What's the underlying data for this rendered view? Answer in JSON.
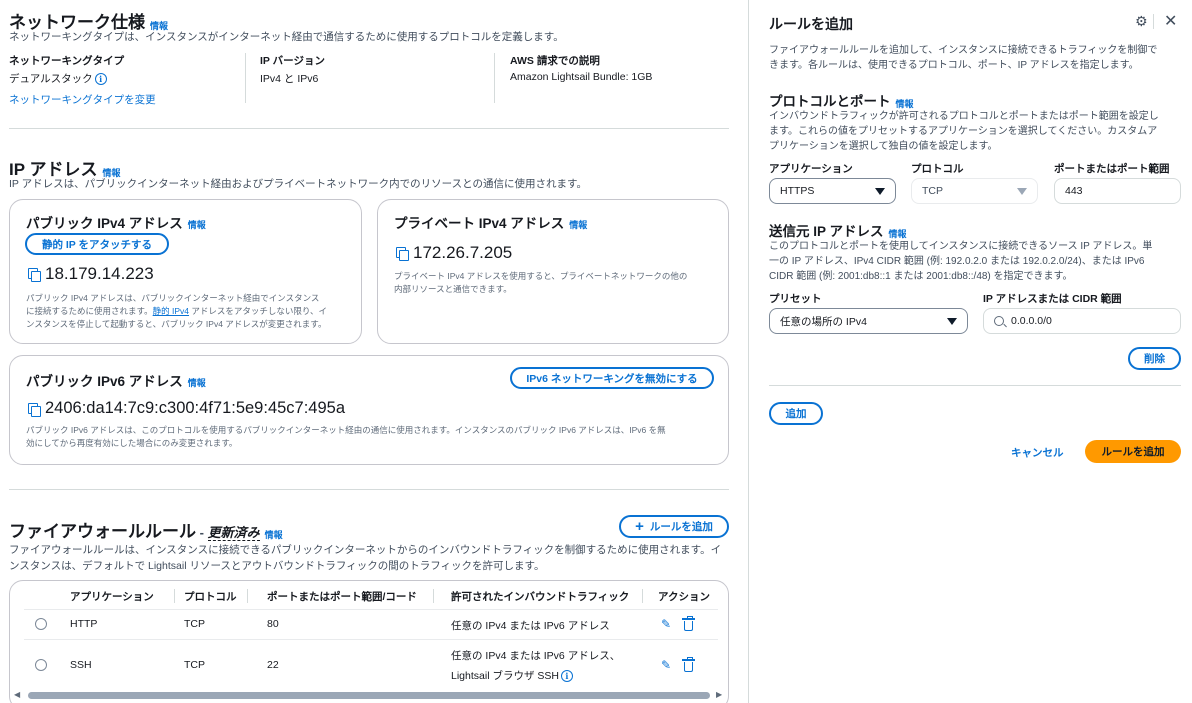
{
  "network": {
    "title": "ネットワーク仕様",
    "info": "情報",
    "desc": "ネットワーキングタイプは、インスタンスがインターネット経由で通信するために使用するプロトコルを定義します。",
    "networking_type_label": "ネットワーキングタイプ",
    "networking_type_value": "デュアルスタック",
    "change_link": "ネットワーキングタイプを変更",
    "ip_version_label": "IP バージョン",
    "ip_version_value": "IPv4 と IPv6",
    "aws_label": "AWS 請求での説明",
    "aws_value": "Amazon Lightsail Bundle: 1GB"
  },
  "ip": {
    "title": "IP アドレス",
    "info": "情報",
    "desc": "IP アドレスは、パブリックインターネット経由およびプライベートネットワーク内でのリソースとの通信に使用されます。",
    "public_v4": {
      "title": "パブリック IPv4 アドレス",
      "info": "情報",
      "attach_btn": "静的 IP をアタッチする",
      "address": "18.179.14.223",
      "desc_1": "パブリック IPv4 アドレスは、パブリックインターネット経由でインスタンス",
      "desc_2a": "に接続するために使用されます。",
      "desc_2link": "静的 IPv4",
      "desc_2b": " アドレスをアタッチしない限り、イ",
      "desc_3": "ンスタンスを停止して起動すると、パブリック IPv4 アドレスが変更されます。"
    },
    "private_v4": {
      "title": "プライベート IPv4 アドレス",
      "info": "情報",
      "address": "172.26.7.205",
      "desc_1": "プライベート IPv4 アドレスを使用すると、プライベートネットワークの他の",
      "desc_2": "内部リソースと通信できます。"
    },
    "public_v6": {
      "title": "パブリック IPv6 アドレス",
      "info": "情報",
      "disable_btn": "IPv6 ネットワーキングを無効にする",
      "address": "2406:da14:7c9:c300:4f71:5e9:45c7:495a",
      "desc_1": "パブリック IPv6 アドレスは、このプロトコルを使用するパブリックインターネット経由の通信に使用されます。インスタンスのパブリック IPv6 アドレスは、IPv6 を無",
      "desc_2": "効にしてから再度有効にした場合にのみ変更されます。"
    }
  },
  "firewall": {
    "title": "ファイアウォールルール",
    "dash": " - ",
    "updated": "更新済み",
    "info": "情報",
    "add_btn": "ルールを追加",
    "desc_1": "ファイアウォールルールは、インスタンスに接続できるパブリックインターネットからのインバウンドトラフィックを制御するために使用されます。イ",
    "desc_2": "ンスタンスは、デフォルトで Lightsail リソースとアウトバウンドトラフィックの間のトラフィックを許可します。",
    "columns": [
      "アプリケーション",
      "プロトコル",
      "ポートまたはポート範囲/コード",
      "許可されたインバウンドトラフィック",
      "アクション"
    ],
    "rows": [
      {
        "app": "HTTP",
        "protocol": "TCP",
        "port": "80",
        "traffic_1": "任意の IPv4 または IPv6 アドレス",
        "traffic_2": ""
      },
      {
        "app": "SSH",
        "protocol": "TCP",
        "port": "22",
        "traffic_1": "任意の IPv4 または IPv6 アドレス、",
        "traffic_2": "Lightsail ブラウザ SSH"
      }
    ]
  },
  "panel": {
    "title": "ルールを追加",
    "desc_1": "ファイアウォールルールを追加して、インスタンスに接続できるトラフィックを制御で",
    "desc_2": "きます。各ルールは、使用できるプロトコル、ポート、IP アドレスを指定します。",
    "proto_title": "プロトコルとポート",
    "info": "情報",
    "proto_desc_1": "インバウンドトラフィックが許可されるプロトコルとポートまたはポート範囲を設定し",
    "proto_desc_2": "ます。これらの値をプリセットするアプリケーションを選択してください。カスタムア",
    "proto_desc_3": "プリケーションを選択して独自の値を設定します。",
    "app_label": "アプリケーション",
    "app_value": "HTTPS",
    "protocol_label": "プロトコル",
    "protocol_value": "TCP",
    "port_label": "ポートまたはポート範囲",
    "port_value": "443",
    "source_title": "送信元 IP アドレス",
    "source_desc_1": "このプロトコルとポートを使用してインスタンスに接続できるソース IP アドレス。単",
    "source_desc_2": "一の IP アドレス、IPv4 CIDR 範囲 (例: 192.0.2.0 または 192.0.2.0/24)、または IPv6",
    "source_desc_3": "CIDR 範囲 (例: 2001:db8::1 または 2001:db8::/48) を指定できます。",
    "preset_label": "プリセット",
    "preset_value": "任意の場所の IPv4",
    "cidr_label": "IP アドレスまたは CIDR 範囲",
    "cidr_value": "0.0.0.0/0",
    "delete_btn": "削除",
    "add_btn": "追加",
    "cancel_btn": "キャンセル",
    "submit_btn": "ルールを追加"
  }
}
